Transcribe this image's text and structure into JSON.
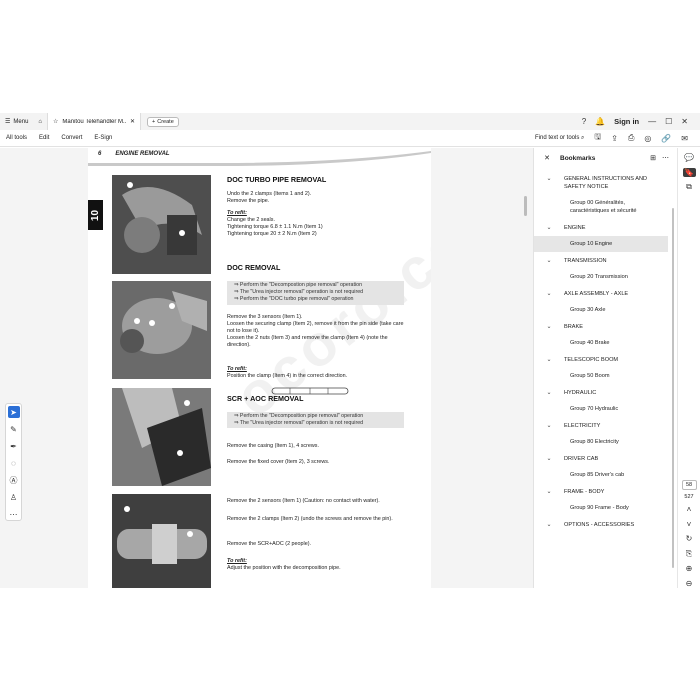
{
  "titlebar": {
    "menu_label": "Menu",
    "tab_title": "Manitou Telehandler M...",
    "create_label": "Create",
    "signin_label": "Sign in"
  },
  "toolbar": {
    "items": [
      "All tools",
      "Edit",
      "Convert",
      "E-Sign"
    ],
    "find_label": "Find text or tools"
  },
  "page": {
    "header_num": "6",
    "header_title": "ENGINE REMOVAL",
    "chapter": "10",
    "watermark": "ocoro.com",
    "s1_title": "DOC TURBO PIPE REMOVAL",
    "s1_l1": "Undo the 2 clamps (Items 1 and 2).",
    "s1_l2": "Remove the pipe.",
    "s1_refit": "To refit:",
    "s1_r1": "Change the 2 seals.",
    "s1_r2": "Tightening torque 6.8 ± 1.1 N.m (Item 1)",
    "s1_r3": "Tightening torque 20 ± 2 N.m (Item 2)",
    "s2_title": "DOC REMOVAL",
    "s2_box1": "⇒  Perform the \"Decompostion pipe removal\" operation",
    "s2_box2": "⇒  The \"Urea injector removal\" operation is not required",
    "s2_box3": "⇒  Perform the \"DOC turbo pipe removal\" operation",
    "s2_l1": "Remove the 3 sensors (Item 1).",
    "s2_l2": "Loosen the securing clamp (Item 2), remove it from the pin side (take care not to lose it).",
    "s2_l3": "Loosen the 2 nuts (Item 3) and remove the clamp (Item 4) (note the direction).",
    "s2_refit": "To refit:",
    "s2_r1": "Position the clamp (Item 4) in the correct direction.",
    "s3_title": "SCR + AOC REMOVAL",
    "s3_box1": "⇒  Perform the \"Decomposition pipe removal\" operation",
    "s3_box2": "⇒  The \"Urea injector removal\" operation is not required",
    "s3_l1": "Remove the casing (Item 1), 4 screws.",
    "s3_l2": "Remove the fixed cover (Item 2), 3 screws.",
    "s4_l1": "Remove the 2 sensors (Item 1) (Caution: no contact with water).",
    "s4_l2": "Remove the 2 clamps (Item 2) (undo the screws and remove the pin).",
    "s4_l3": "Remove the SCR+AOC (2 people).",
    "s4_refit": "To refit:",
    "s4_r1": "Adjust the position with the decomposition pipe."
  },
  "bookmarks": {
    "title": "Bookmarks",
    "items": [
      {
        "parent": "GENERAL INSTRUCTIONS AND SAFETY NOTICE",
        "child": "Group 00 Généralités, caractéristiques et sécurité"
      },
      {
        "parent": "ENGINE",
        "child": "Group 10 Engine"
      },
      {
        "parent": "TRANSMISSION",
        "child": "Group 20 Transmission"
      },
      {
        "parent": "AXLE ASSEMBLY - AXLE",
        "child": "Group 30 Axle"
      },
      {
        "parent": "BRAKE",
        "child": "Group 40 Brake"
      },
      {
        "parent": "TELESCOPIC BOOM",
        "child": "Group 50 Boom"
      },
      {
        "parent": "HYDRAULIC",
        "child": "Group 70 Hydraulic"
      },
      {
        "parent": "ELECTRICITY",
        "child": "Group 80 Electricity"
      },
      {
        "parent": "DRIVER CAB",
        "child": "Group 85 Driver's cab"
      },
      {
        "parent": "FRAME - BODY",
        "child": "Group 90 Frame - Body"
      },
      {
        "parent": "OPTIONS - ACCESSORIES",
        "child": ""
      }
    ],
    "selected_index": 1
  },
  "nav": {
    "current_page": "58",
    "total_pages": "527"
  }
}
